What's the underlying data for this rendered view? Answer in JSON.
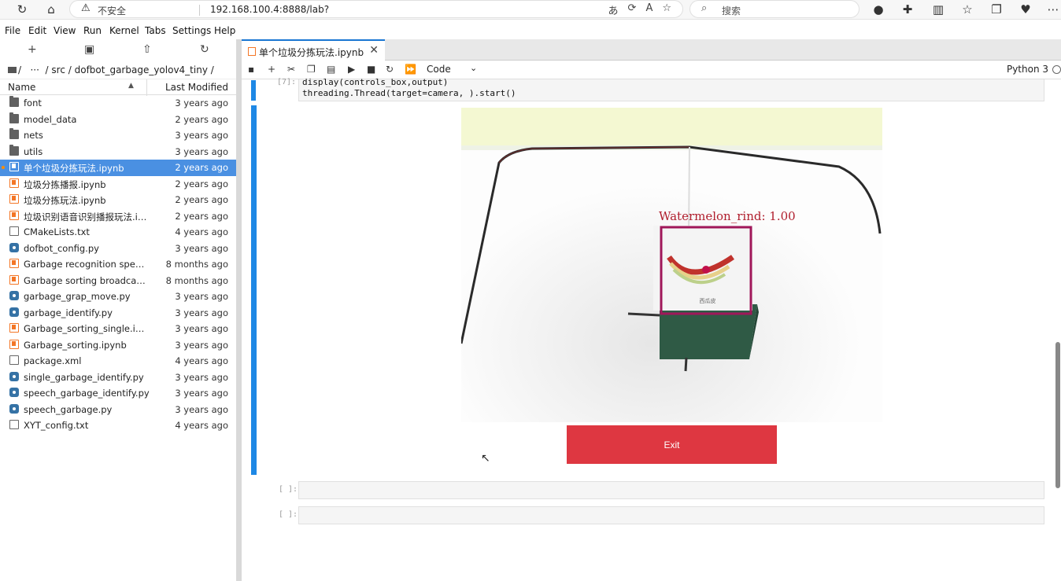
{
  "browser": {
    "insecure_label": "不安全",
    "url": "192.168.100.4:8888/lab?",
    "search_placeholder": "搜索"
  },
  "menu": [
    "File",
    "Edit",
    "View",
    "Run",
    "Kernel",
    "Tabs",
    "Settings",
    "Help"
  ],
  "filebrowser": {
    "breadcrumb": "/   ···  / src / dofbot_garbage_yolov4_tiny /",
    "col_name": "Name",
    "col_modified": "Last Modified",
    "files": [
      {
        "name": "font",
        "type": "folder",
        "modified": "3 years ago"
      },
      {
        "name": "model_data",
        "type": "folder",
        "modified": "2 years ago"
      },
      {
        "name": "nets",
        "type": "folder",
        "modified": "3 years ago"
      },
      {
        "name": "utils",
        "type": "folder",
        "modified": "3 years ago"
      },
      {
        "name": "单个垃圾分拣玩法.ipynb",
        "type": "notebook",
        "modified": "2 years ago",
        "selected": true
      },
      {
        "name": "垃圾分拣播报.ipynb",
        "type": "notebook",
        "modified": "2 years ago"
      },
      {
        "name": "垃圾分拣玩法.ipynb",
        "type": "notebook",
        "modified": "2 years ago"
      },
      {
        "name": "垃圾识别语音识别播报玩法.ipy...",
        "type": "notebook",
        "modified": "2 years ago"
      },
      {
        "name": "CMakeLists.txt",
        "type": "text",
        "modified": "4 years ago"
      },
      {
        "name": "dofbot_config.py",
        "type": "python",
        "modified": "3 years ago"
      },
      {
        "name": "Garbage recognition speech re...",
        "type": "notebook",
        "modified": "8 months ago"
      },
      {
        "name": "Garbage sorting broadcast ga...",
        "type": "notebook",
        "modified": "8 months ago"
      },
      {
        "name": "garbage_grap_move.py",
        "type": "python",
        "modified": "3 years ago"
      },
      {
        "name": "garbage_identify.py",
        "type": "python",
        "modified": "3 years ago"
      },
      {
        "name": "Garbage_sorting_single.ipynb",
        "type": "notebook",
        "modified": "3 years ago"
      },
      {
        "name": "Garbage_sorting.ipynb",
        "type": "notebook",
        "modified": "3 years ago"
      },
      {
        "name": "package.xml",
        "type": "text",
        "modified": "4 years ago"
      },
      {
        "name": "single_garbage_identify.py",
        "type": "python",
        "modified": "3 years ago"
      },
      {
        "name": "speech_garbage_identify.py",
        "type": "python",
        "modified": "3 years ago"
      },
      {
        "name": "speech_garbage.py",
        "type": "python",
        "modified": "3 years ago"
      },
      {
        "name": "XYT_config.txt",
        "type": "text",
        "modified": "4 years ago"
      }
    ]
  },
  "notebook": {
    "tab_title": "单个垃圾分拣玩法.ipynb",
    "cell_type": "Code",
    "kernel": "Python 3",
    "code_prompt": "[7]:",
    "code_lines": [
      "display(controls_box,output)",
      "threading.Thread(target=camera, ).start()"
    ],
    "detection_label": "Watermelon_rind: 1.00",
    "card_caption": "西瓜皮",
    "exit_label": "Exit",
    "empty_prompt_1": "[ ]:",
    "empty_prompt_2": "[ ]:"
  }
}
